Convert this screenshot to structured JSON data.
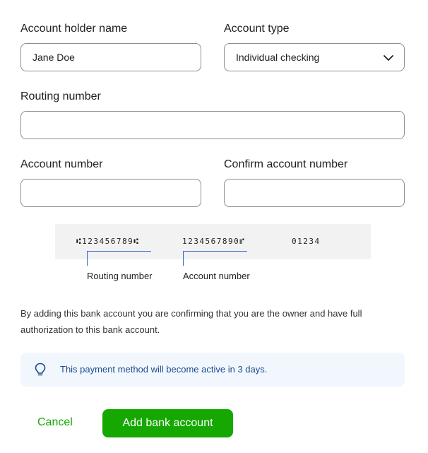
{
  "form": {
    "account_holder_label": "Account holder name",
    "account_holder_value": "Jane Doe",
    "account_type_label": "Account type",
    "account_type_value": "Individual checking",
    "routing_label": "Routing number",
    "routing_value": "",
    "account_number_label": "Account number",
    "account_number_value": "",
    "confirm_account_label": "Confirm account number",
    "confirm_account_value": ""
  },
  "check_illustration": {
    "micr_routing": "⑆123456789⑆",
    "micr_account": "1234567890⑈",
    "micr_check": "01234",
    "routing_caption": "Routing number",
    "account_caption": "Account number"
  },
  "notice": "By adding this bank account you are confirming that you are the owner and have full authorization to this bank account.",
  "info": {
    "icon": "lightbulb-icon",
    "text": "This payment method will become active in 3 days."
  },
  "actions": {
    "cancel_label": "Cancel",
    "submit_label": "Add bank account"
  },
  "colors": {
    "accent": "#14a800",
    "info_bg": "#f2f7fd",
    "info_text": "#1a4d8f",
    "bracket": "#3563c8"
  }
}
